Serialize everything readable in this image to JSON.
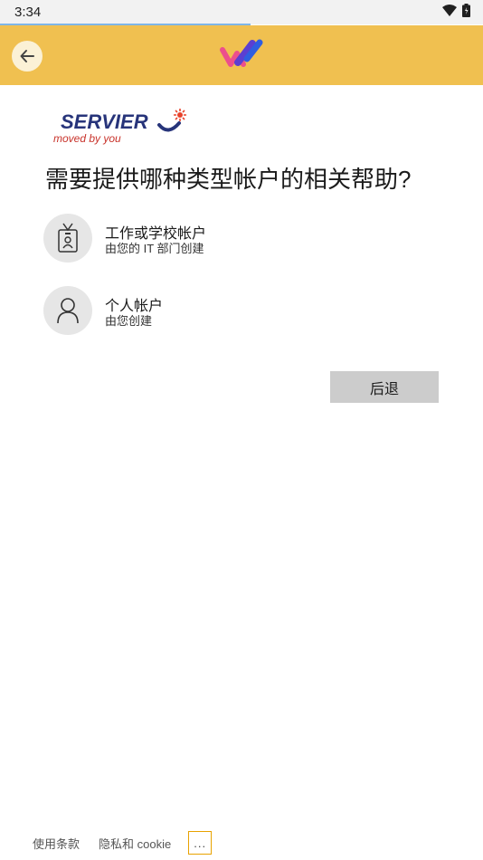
{
  "status": {
    "time": "3:34"
  },
  "header": {
    "back_icon": "arrow-left-icon",
    "logo": "app-logo"
  },
  "brand": {
    "name": "SERVIER",
    "tagline": "moved by you"
  },
  "page": {
    "title": "需要提供哪种类型帐户的相关帮助?"
  },
  "options": [
    {
      "title": "工作或学校帐户",
      "subtitle": "由您的 IT 部门创建",
      "icon": "id-badge-icon"
    },
    {
      "title": "个人帐户",
      "subtitle": "由您创建",
      "icon": "person-icon"
    }
  ],
  "actions": {
    "back_label": "后退"
  },
  "footer": {
    "terms": "使用条款",
    "privacy": "隐私和 cookie",
    "more": "..."
  },
  "colors": {
    "header": "#f0c050",
    "button": "#cccccc",
    "icon_bg": "#e6e6e6"
  }
}
